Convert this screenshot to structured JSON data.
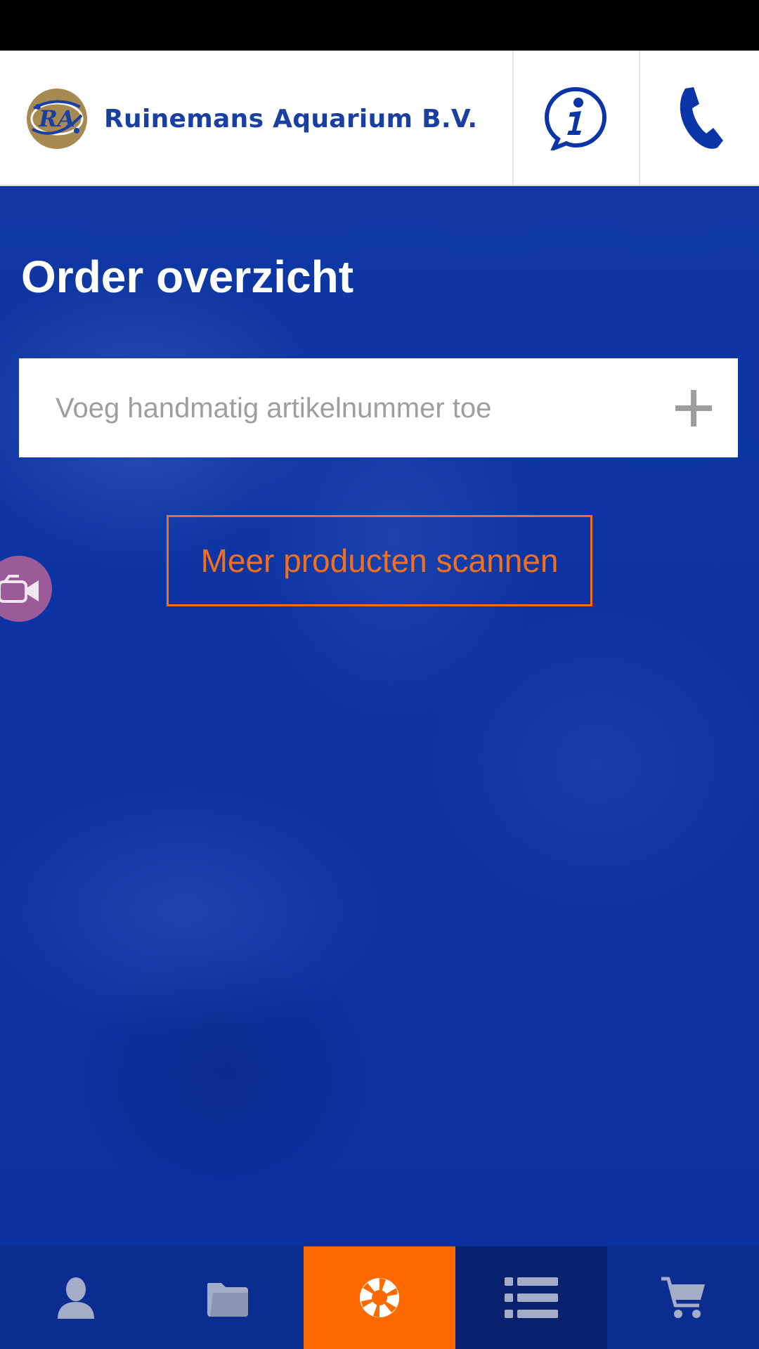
{
  "header": {
    "brand_name": "Ruinemans Aquarium B.V.",
    "logo_monogram": "RA",
    "icons": [
      "info-icon",
      "phone-icon"
    ]
  },
  "main": {
    "title": "Order overzicht",
    "article_input": {
      "placeholder": "Voeg handmatig artikelnummer toe",
      "value": ""
    },
    "scan_button_label": "Meer producten scannen"
  },
  "bottom_nav": {
    "items": [
      {
        "icon": "user-icon",
        "active": false
      },
      {
        "icon": "folder-icon",
        "active": false
      },
      {
        "icon": "camera-shutter-icon",
        "active": true
      },
      {
        "icon": "list-icon",
        "active": false
      },
      {
        "icon": "cart-icon",
        "active": false
      }
    ]
  },
  "colors": {
    "brand_blue": "#1a3fa3",
    "background_blue": "#0a2f9a",
    "accent_orange": "#ff6a00",
    "logo_gold": "#a68a52",
    "nav_icon_gray": "#a3adc8"
  }
}
